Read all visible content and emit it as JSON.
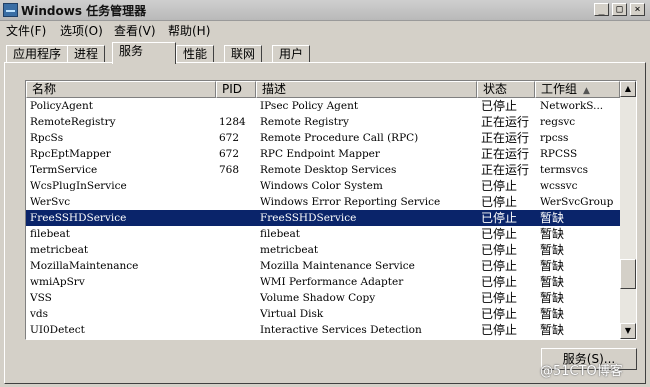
{
  "window": {
    "title": "Windows 任务管理器",
    "controls": {
      "minimize": "_",
      "maximize": "□",
      "close": "×"
    }
  },
  "menu": [
    "文件(F)",
    "选项(O)",
    "查看(V)",
    "帮助(H)"
  ],
  "tabs": [
    {
      "label": "应用程序",
      "active": false
    },
    {
      "label": "进程",
      "active": false
    },
    {
      "label": "服务",
      "active": true
    },
    {
      "label": "性能",
      "active": false
    },
    {
      "label": "联网",
      "active": false
    },
    {
      "label": "用户",
      "active": false
    }
  ],
  "columns": [
    "名称",
    "PID",
    "描述",
    "状态",
    "工作组"
  ],
  "rows": [
    [
      "PolicyAgent",
      "",
      "IPsec Policy Agent",
      "已停止",
      "NetworkS..."
    ],
    [
      "RemoteRegistry",
      "1284",
      "Remote Registry",
      "正在运行",
      "regsvc"
    ],
    [
      "RpcSs",
      "672",
      "Remote Procedure Call (RPC)",
      "正在运行",
      "rpcss"
    ],
    [
      "RpcEptMapper",
      "672",
      "RPC Endpoint Mapper",
      "正在运行",
      "RPCSS"
    ],
    [
      "TermService",
      "768",
      "Remote Desktop Services",
      "正在运行",
      "termsvcs"
    ],
    [
      "WcsPlugInService",
      "",
      "Windows Color System",
      "已停止",
      "wcssvc"
    ],
    [
      "WerSvc",
      "",
      "Windows Error Reporting Service",
      "已停止",
      "WerSvcGroup"
    ],
    [
      "FreeSSHDService",
      "",
      "FreeSSHDService",
      "已停止",
      "暂缺"
    ],
    [
      "filebeat",
      "",
      "filebeat",
      "已停止",
      "暂缺"
    ],
    [
      "metricbeat",
      "",
      "metricbeat",
      "已停止",
      "暂缺"
    ],
    [
      "MozillaMaintenance",
      "",
      "Mozilla Maintenance Service",
      "已停止",
      "暂缺"
    ],
    [
      "wmiApSrv",
      "",
      "WMI Performance Adapter",
      "已停止",
      "暂缺"
    ],
    [
      "VSS",
      "",
      "Volume Shadow Copy",
      "已停止",
      "暂缺"
    ],
    [
      "vds",
      "",
      "Virtual Disk",
      "已停止",
      "暂缺"
    ],
    [
      "UI0Detect",
      "",
      "Interactive Services Detection",
      "已停止",
      "暂缺"
    ]
  ],
  "selected_row": 7,
  "services_button": "服务(S)...",
  "watermark": "@51CTO博客",
  "colors": {
    "selection": "#0a246a",
    "face": "#d4d0c8"
  }
}
